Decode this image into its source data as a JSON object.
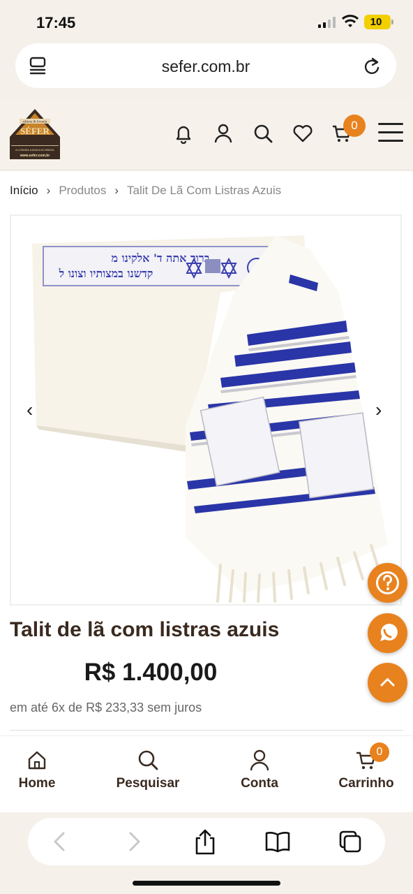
{
  "status_bar": {
    "time": "17:45",
    "battery": "10"
  },
  "browser": {
    "url": "sefer.com.br"
  },
  "site": {
    "logo_alt": "Editora & Livraria Sefer",
    "logo_text": "SÉFER",
    "logo_top_text": "editora & livraria",
    "logo_tagline": "A LIVRARIA JUDAICA DO BRASIL",
    "logo_url": "www.sefer.com.br",
    "cart_count": "0"
  },
  "breadcrumb": {
    "home": "Início",
    "category": "Produtos",
    "current": "Talit De Lã Com Listras Azuis"
  },
  "product": {
    "title": "Talit de lã com listras azuis",
    "price": "R$ 1.400,00",
    "installments": "em até 6x de R$ 233,33 sem juros",
    "image_alt": "Talit de lã com listras azuis",
    "hebrew_line1": "ברוך אתה ד' אלקינו מ",
    "hebrew_line2": "קדשנו במצותיו וצונו ל"
  },
  "bottom_nav": {
    "home": "Home",
    "search": "Pesquisar",
    "account": "Conta",
    "cart": "Carrinho",
    "cart_count": "0"
  },
  "colors": {
    "accent": "#e8821e",
    "brand_dark": "#3a2a20",
    "stripe_blue": "#2a35a8"
  }
}
